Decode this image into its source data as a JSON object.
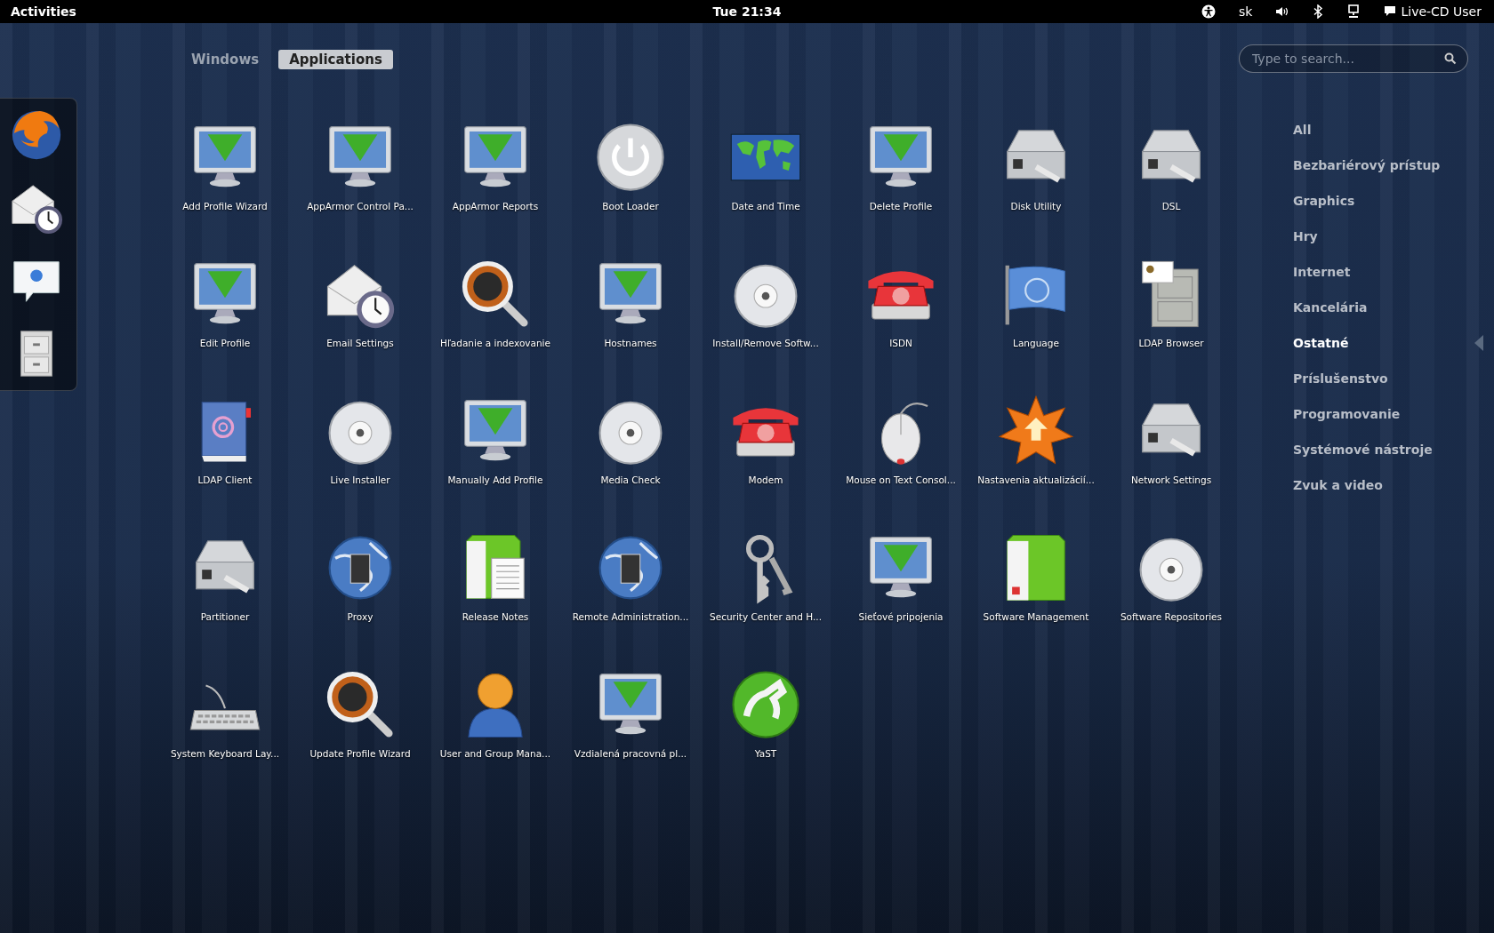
{
  "top_bar": {
    "activities": "Activities",
    "clock": "Tue 21:34",
    "keyboard_layout": "sk",
    "user": "Live-CD User"
  },
  "view_tabs": [
    {
      "label": "Windows",
      "selected": false
    },
    {
      "label": "Applications",
      "selected": true
    }
  ],
  "search": {
    "placeholder": "Type to search..."
  },
  "apps": [
    {
      "label": "Add Profile Wizard",
      "kind": "monitor"
    },
    {
      "label": "AppArmor Control Pa...",
      "kind": "monitor"
    },
    {
      "label": "AppArmor Reports",
      "kind": "monitor"
    },
    {
      "label": "Boot Loader",
      "kind": "power"
    },
    {
      "label": "Date and Time",
      "kind": "map"
    },
    {
      "label": "Delete Profile",
      "kind": "monitor"
    },
    {
      "label": "Disk Utility",
      "kind": "drive"
    },
    {
      "label": "DSL",
      "kind": "drive"
    },
    {
      "label": "Edit Profile",
      "kind": "monitor"
    },
    {
      "label": "Email Settings",
      "kind": "envelope"
    },
    {
      "label": "Hľadanie a indexovanie",
      "kind": "magnifier"
    },
    {
      "label": "Hostnames",
      "kind": "monitor"
    },
    {
      "label": "Install/Remove Softw...",
      "kind": "disc"
    },
    {
      "label": "ISDN",
      "kind": "phone"
    },
    {
      "label": "Language",
      "kind": "flag"
    },
    {
      "label": "LDAP Browser",
      "kind": "cabinet"
    },
    {
      "label": "LDAP Client",
      "kind": "book"
    },
    {
      "label": "Live Installer",
      "kind": "disc"
    },
    {
      "label": "Manually Add Profile",
      "kind": "monitor"
    },
    {
      "label": "Media Check",
      "kind": "disc"
    },
    {
      "label": "Modem",
      "kind": "phone"
    },
    {
      "label": "Mouse on Text Consol...",
      "kind": "mouse"
    },
    {
      "label": "Nastavenia aktualizácií...",
      "kind": "star"
    },
    {
      "label": "Network Settings",
      "kind": "drive"
    },
    {
      "label": "Partitioner",
      "kind": "drive"
    },
    {
      "label": "Proxy",
      "kind": "globe"
    },
    {
      "label": "Release Notes",
      "kind": "document"
    },
    {
      "label": "Remote Administration...",
      "kind": "globe"
    },
    {
      "label": "Security Center and H...",
      "kind": "keys"
    },
    {
      "label": "Sieťové pripojenia",
      "kind": "monitor"
    },
    {
      "label": "Software Management",
      "kind": "package"
    },
    {
      "label": "Software Repositories",
      "kind": "disc"
    },
    {
      "label": "System Keyboard Lay...",
      "kind": "keyboard"
    },
    {
      "label": "Update Profile Wizard",
      "kind": "magnifier"
    },
    {
      "label": "User and Group Mana...",
      "kind": "person"
    },
    {
      "label": "Vzdialená pracovná pl...",
      "kind": "monitor"
    },
    {
      "label": "YaST",
      "kind": "orb"
    }
  ],
  "categories": [
    {
      "label": "All",
      "selected": false
    },
    {
      "label": "Bezbariérový prístup",
      "selected": false
    },
    {
      "label": "Graphics",
      "selected": false
    },
    {
      "label": "Hry",
      "selected": false
    },
    {
      "label": "Internet",
      "selected": false
    },
    {
      "label": "Kancelária",
      "selected": false
    },
    {
      "label": "Ostatné",
      "selected": true
    },
    {
      "label": "Príslušenstvo",
      "selected": false
    },
    {
      "label": "Programovanie",
      "selected": false
    },
    {
      "label": "Systémové nástroje",
      "selected": false
    },
    {
      "label": "Zvuk a video",
      "selected": false
    }
  ]
}
